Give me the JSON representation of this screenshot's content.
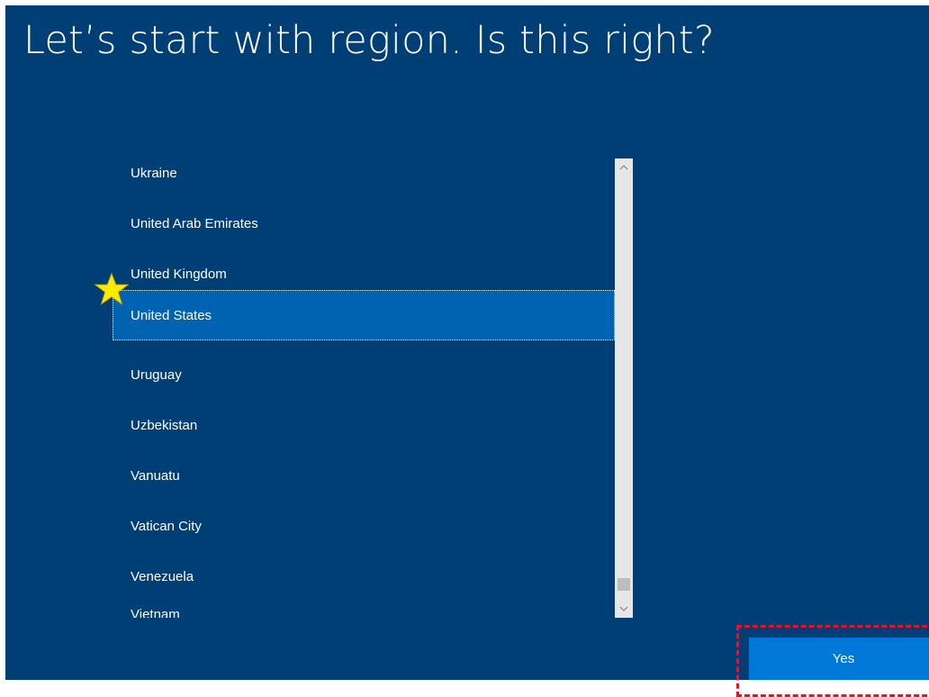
{
  "title": "Let’s start with region. Is this right?",
  "regions": [
    {
      "label": "Ukraine",
      "selected": false
    },
    {
      "label": "United Arab Emirates",
      "selected": false
    },
    {
      "label": "United Kingdom",
      "selected": false
    },
    {
      "label": "United States",
      "selected": true
    },
    {
      "label": "Uruguay",
      "selected": false
    },
    {
      "label": "Uzbekistan",
      "selected": false
    },
    {
      "label": "Vanuatu",
      "selected": false
    },
    {
      "label": "Vatican City",
      "selected": false
    },
    {
      "label": "Venezuela",
      "selected": false
    },
    {
      "label": "Vietnam",
      "selected": false
    }
  ],
  "scrollbar": {
    "up_icon": "chevron-up-icon",
    "down_icon": "chevron-down-icon"
  },
  "yes_button_label": "Yes",
  "annotations": {
    "star_marker": "star-icon",
    "highlight_color": "#e8102b",
    "star_color": "#ffeb00"
  },
  "colors": {
    "background": "#003f75",
    "selected_item": "#0063b1",
    "button": "#0078d7",
    "scrollbar_track": "#e6e6e6"
  }
}
